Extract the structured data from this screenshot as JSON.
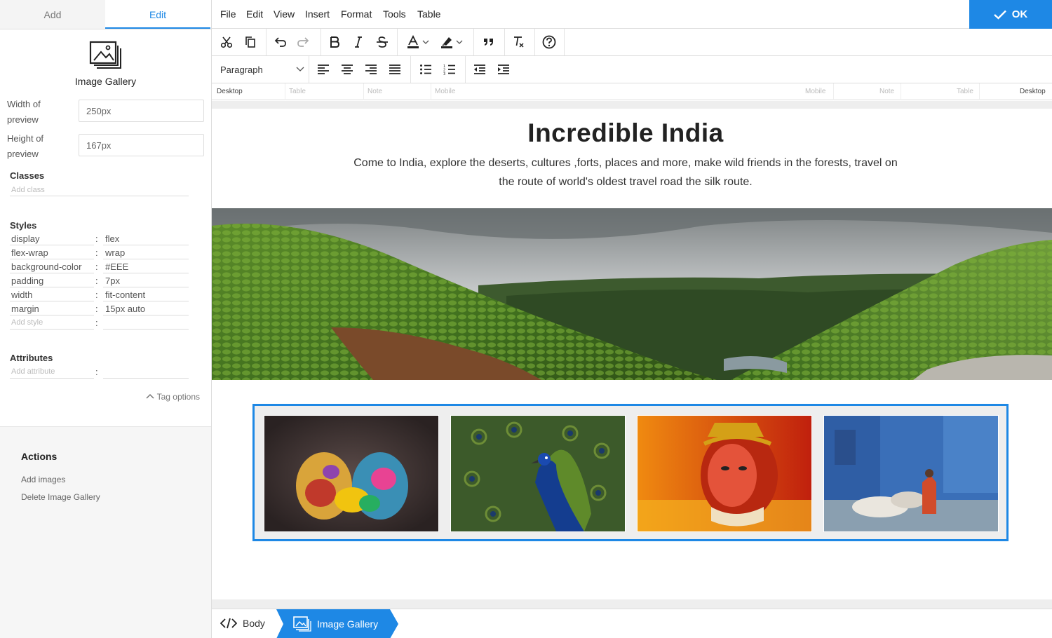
{
  "tabs": [
    {
      "label": "Add"
    },
    {
      "label": "Edit"
    }
  ],
  "component": {
    "name": "Image Gallery"
  },
  "fields": {
    "width": {
      "label_line1": "Width of",
      "label_line2": "preview",
      "value": "250px"
    },
    "height": {
      "label_line1": "Height of",
      "label_line2": "preview",
      "value": "167px"
    }
  },
  "classes": {
    "title": "Classes",
    "placeholder": "Add class"
  },
  "styles": {
    "title": "Styles",
    "rows": [
      {
        "key": "display",
        "value": "flex"
      },
      {
        "key": "flex-wrap",
        "value": "wrap"
      },
      {
        "key": "background-color",
        "value": "#EEE"
      },
      {
        "key": "padding",
        "value": "7px"
      },
      {
        "key": "width",
        "value": "fit-content"
      },
      {
        "key": "margin",
        "value": "15px auto"
      }
    ],
    "placeholder": "Add style",
    "separator": ":"
  },
  "attributes": {
    "title": "Attributes",
    "placeholder": "Add attribute",
    "separator": ":"
  },
  "tag_options": "Tag options",
  "actions": {
    "title": "Actions",
    "items": [
      "Add images",
      "Delete Image Gallery"
    ]
  },
  "menu": [
    "File",
    "Edit",
    "View",
    "Insert",
    "Format",
    "Tools",
    "Table"
  ],
  "ok_label": "OK",
  "format_select": "Paragraph",
  "ruler": [
    "Desktop",
    "Table",
    "Note",
    "Mobile",
    "Mobile",
    "Note",
    "Table",
    "Desktop"
  ],
  "content": {
    "title": "Incredible India",
    "description": "Come to India, explore the deserts, cultures ,forts, places and more, make wild friends in the forests, travel on the route of world's oldest travel road the silk route."
  },
  "breadcrumb": {
    "body": "Body",
    "current": "Image Gallery"
  },
  "colors": {
    "accent": "#1e88e5"
  }
}
